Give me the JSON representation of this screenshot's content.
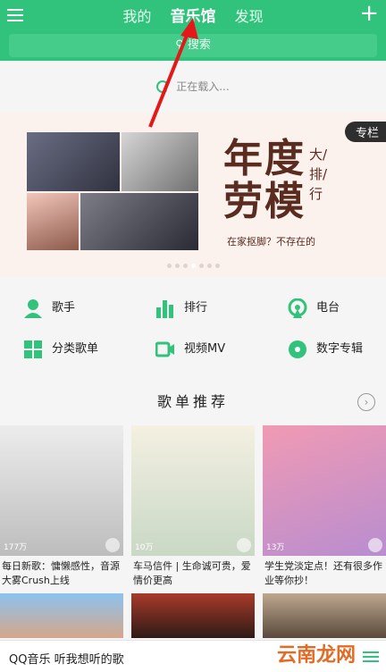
{
  "header": {
    "tabs": [
      {
        "label": "我的"
      },
      {
        "label": "音乐馆"
      },
      {
        "label": "发现"
      }
    ],
    "search_label": "搜索"
  },
  "loading_text": "正在载入...",
  "banner": {
    "tag": "专栏",
    "headline_line1": "年度",
    "headline_line2": "劳模",
    "side_text": "大/排/行",
    "subtitle": "在家抠脚？不存在的"
  },
  "nav": [
    {
      "label": "歌手",
      "icon": "singer-icon"
    },
    {
      "label": "排行",
      "icon": "ranking-icon"
    },
    {
      "label": "电台",
      "icon": "radio-icon"
    },
    {
      "label": "分类歌单",
      "icon": "category-icon"
    },
    {
      "label": "视频MV",
      "icon": "video-icon"
    },
    {
      "label": "数字专辑",
      "icon": "album-icon"
    }
  ],
  "section": {
    "title": "歌单推荐"
  },
  "cards": [
    {
      "count": "177万",
      "caption": "每日新歌：慵懒感性，音源大雾Crush上线"
    },
    {
      "count": "10万",
      "caption": "车马信件 | 生命诚可贵，爱情价更高"
    },
    {
      "count": "13万",
      "caption": "学生党淡定点！还有很多作业等你抄！"
    }
  ],
  "footer": {
    "text": "QQ音乐 听我想听的歌",
    "watermark": "云南龙网"
  },
  "colors": {
    "brand_green": "#31c27c"
  }
}
